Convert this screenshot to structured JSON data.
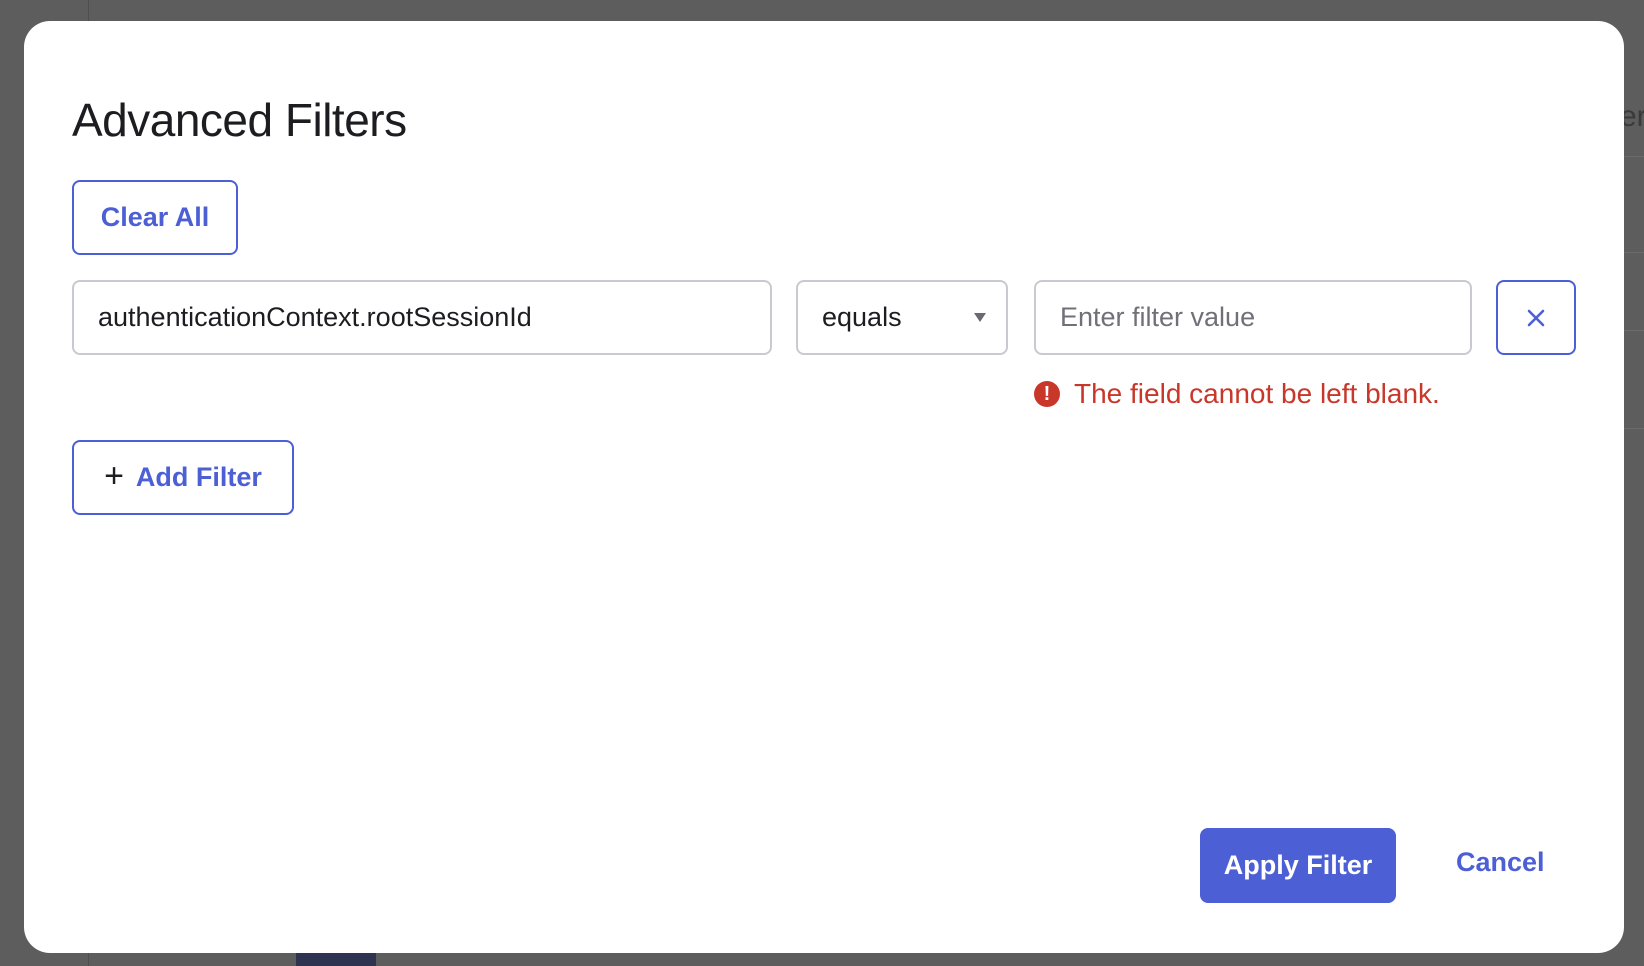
{
  "modal": {
    "title": "Advanced Filters",
    "clear_all_label": "Clear All",
    "add_filter_label": "Add Filter",
    "apply_label": "Apply Filter",
    "cancel_label": "Cancel"
  },
  "filter_row": {
    "field_value": "authenticationContext.rootSessionId",
    "operator": "equals",
    "value_placeholder": "Enter filter value",
    "value": "",
    "error": "The field cannot be left blank."
  },
  "background": {
    "peek_text": "er"
  },
  "colors": {
    "accent": "#4c5fd5",
    "error": "#c8372a",
    "backdrop": "#5d5d5d"
  },
  "icons": {
    "remove": "close-icon",
    "add": "plus-icon",
    "error": "error-icon",
    "dropdown": "caret-down-icon"
  }
}
